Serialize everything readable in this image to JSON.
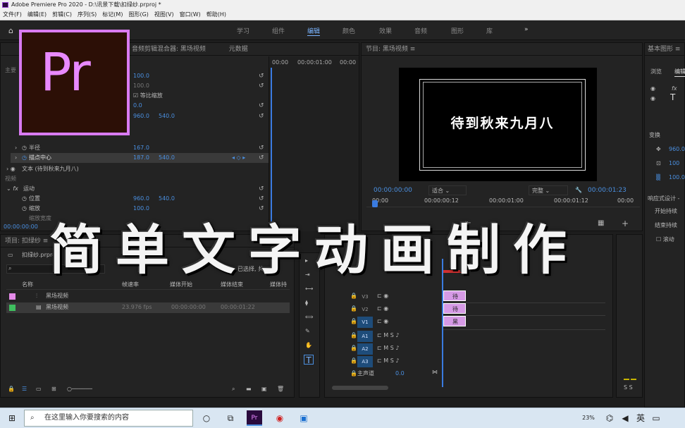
{
  "window": {
    "title": "Adobe Premiere Pro 2020 - D:\\讯景下载\\扣绿纱.prproj *"
  },
  "menu": [
    "文件(F)",
    "编辑(E)",
    "剪辑(C)",
    "序列(S)",
    "标记(M)",
    "图形(G)",
    "视图(V)",
    "窗口(W)",
    "帮助(H)"
  ],
  "workspace": {
    "tabs": [
      "学习",
      "组件",
      "编辑",
      "颜色",
      "效果",
      "音频",
      "图形",
      "库"
    ],
    "active": "编辑",
    "more": "»"
  },
  "effect_controls": {
    "tab_mixer": "音频剪辑混合器: 黑场视频",
    "tab_metadata": "元数据",
    "header_left": "主要",
    "rows": [
      {
        "label": "",
        "v1": "100.0",
        "v2": ""
      },
      {
        "label": "",
        "v1": "100.0",
        "v2": ""
      },
      {
        "label": "等比缩放",
        "v1": "",
        "v2": ""
      },
      {
        "label": "",
        "v1": "0.0",
        "v2": ""
      },
      {
        "label": "",
        "v1": "960.0",
        "v2": "540.0"
      }
    ],
    "fx_rows": [
      {
        "label": "半径",
        "v1": "167.0",
        "v2": ""
      },
      {
        "label": "描点中心",
        "v1": "187.0",
        "v2": "540.0"
      }
    ],
    "text_layer": "文本 (待到秋来九月八)",
    "video_section": "视频",
    "motion": "运动",
    "motion_rows": [
      {
        "label": "位置",
        "v1": "960.0",
        "v2": "540.0"
      },
      {
        "label": "缩放",
        "v1": "100.0",
        "v2": ""
      },
      {
        "label": "缩放宽度",
        "v1": "",
        "v2": ""
      }
    ],
    "timecode": "00:00:00:00",
    "ruler": [
      "00:00",
      "00:00:01:00",
      "00:00"
    ]
  },
  "program": {
    "title": "节目: 黑场视频",
    "screen_text": "待到秋来九月八",
    "timecode": "00:00:00:00",
    "fit": "适合",
    "quality": "完整",
    "duration": "00:00:01:23",
    "ruler": [
      "00:00",
      "00:00:00:12",
      "00:00:01:00",
      "00:00:01:12",
      "00:00"
    ]
  },
  "essential_graphics": {
    "title": "基本图形",
    "tabs": [
      "浏览",
      "编辑"
    ],
    "transform": "变换",
    "position_value": "960.0",
    "scale_value": "100",
    "opacity_value": "100.0",
    "responsive": "响应式设计 -",
    "start_hold": "开始持续",
    "end_hold": "结束持续",
    "roll": "滚动"
  },
  "project": {
    "title": "项目: 扣绿纱",
    "file": "扣绿纱.prproj",
    "selected_info": "已选择, 共",
    "columns": [
      "名称",
      "帧速率",
      "媒体开始",
      "媒体结束",
      "媒体持"
    ],
    "items": [
      {
        "name": "黑场视频",
        "fps": "",
        "start": "",
        "end": "",
        "color": "#e48ae8"
      },
      {
        "name": "黑场视频",
        "fps": "23.976 fps",
        "start": "00:00:00:00",
        "end": "00:00:01:22",
        "color": "#3fbf5f"
      }
    ]
  },
  "timeline": {
    "tracks": [
      "V3",
      "V2",
      "V1",
      "A1",
      "A2",
      "A3"
    ],
    "master": "主声道",
    "master_value": "0.0",
    "clips": [
      {
        "label": "待"
      },
      {
        "label": "待"
      },
      {
        "label": "黑"
      }
    ]
  },
  "overlay": {
    "title": "简单文字动画制作",
    "logo_text": "Pr"
  },
  "taskbar": {
    "search_placeholder": "在这里输入你要搜索的内容",
    "battery": "23%"
  },
  "colors": {
    "accent": "#4a8fe0",
    "clip": "#d69ae6",
    "logo_border": "#d97bf2"
  }
}
